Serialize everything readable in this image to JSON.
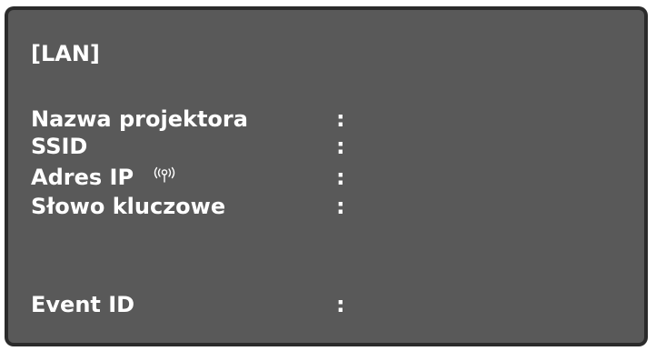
{
  "screen": {
    "title": "[LAN]",
    "colors": {
      "background": "#595959",
      "border": "#2b2b2b",
      "text": "#ffffff"
    },
    "rows": [
      {
        "label": "Nazwa projektora",
        "separator": ":",
        "value": ""
      },
      {
        "label": "SSID",
        "separator": ":",
        "value": ""
      },
      {
        "label": "Adres IP",
        "separator": ":",
        "value": "",
        "icon": "wireless-signal-icon"
      },
      {
        "label": "Słowo kluczowe",
        "separator": ":",
        "value": ""
      },
      {
        "label": "Event ID",
        "separator": ":",
        "value": ""
      }
    ]
  }
}
